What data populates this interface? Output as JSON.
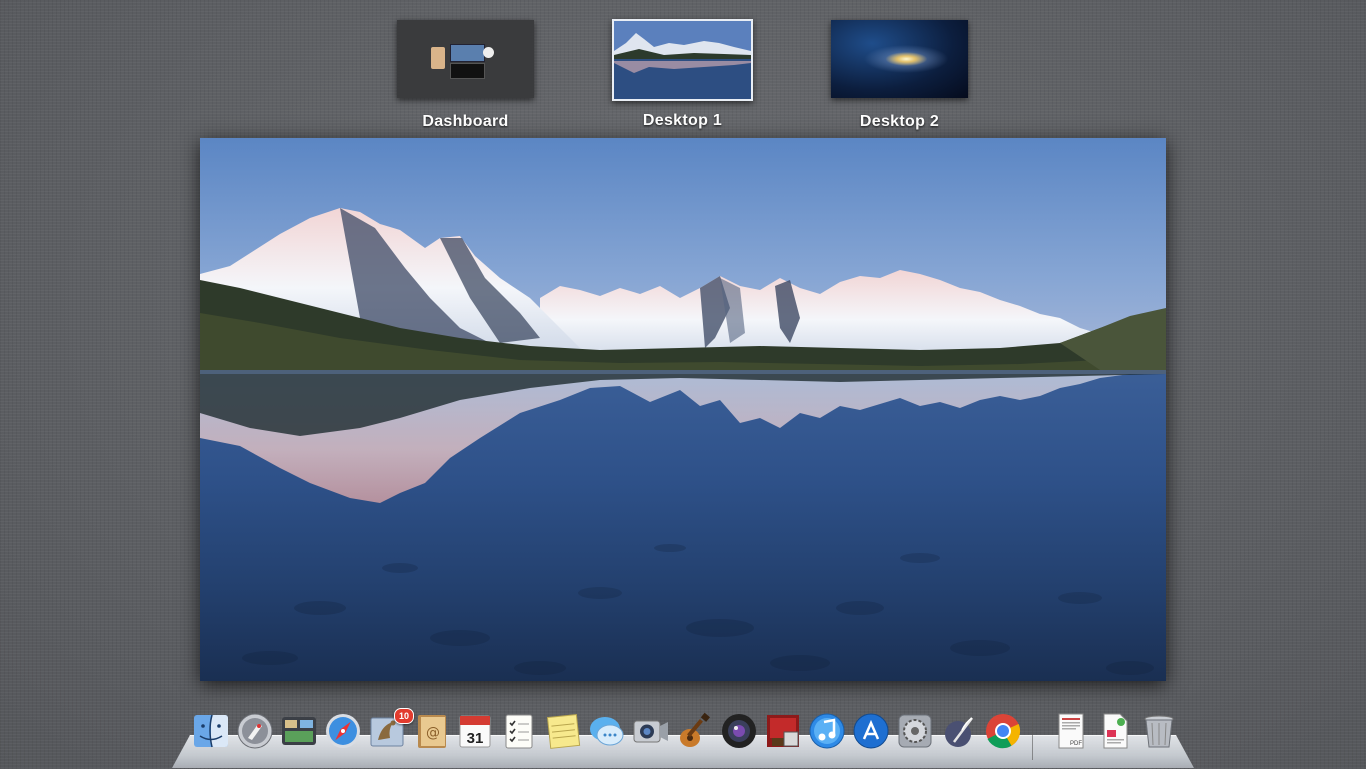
{
  "spaces": [
    {
      "label": "Dashboard",
      "thumb": "dashboard-thumbnail"
    },
    {
      "label": "Desktop 1",
      "thumb": "mountain-lake-thumbnail",
      "active": true
    },
    {
      "label": "Desktop 2",
      "thumb": "galaxy-thumbnail"
    }
  ],
  "desktop_preview": {
    "wallpaper": "mountain-lake-reflection"
  },
  "dock": {
    "items": [
      {
        "name": "Finder",
        "icon": "finder-icon"
      },
      {
        "name": "Launchpad",
        "icon": "launchpad-icon"
      },
      {
        "name": "Mission Control",
        "icon": "mission-control-icon"
      },
      {
        "name": "Safari",
        "icon": "safari-icon"
      },
      {
        "name": "Mail",
        "icon": "mail-icon",
        "badge": "10"
      },
      {
        "name": "Contacts",
        "icon": "contacts-icon"
      },
      {
        "name": "Calendar",
        "icon": "calendar-icon",
        "date": "31"
      },
      {
        "name": "Reminders",
        "icon": "reminders-icon"
      },
      {
        "name": "Notes",
        "icon": "notes-icon"
      },
      {
        "name": "Messages",
        "icon": "messages-icon"
      },
      {
        "name": "FaceTime",
        "icon": "facetime-icon"
      },
      {
        "name": "GarageBand",
        "icon": "garageband-icon"
      },
      {
        "name": "Photo Booth",
        "icon": "photo-booth-icon"
      },
      {
        "name": "Photo Booth Theater",
        "icon": "movie-theater-icon"
      },
      {
        "name": "iTunes",
        "icon": "itunes-icon"
      },
      {
        "name": "App Store",
        "icon": "app-store-icon"
      },
      {
        "name": "System Preferences",
        "icon": "system-preferences-icon"
      },
      {
        "name": "Preview",
        "icon": "quill-icon"
      },
      {
        "name": "Google Chrome",
        "icon": "chrome-icon"
      },
      {
        "name": "PDF Document",
        "icon": "pdf-document-icon",
        "doc_label": "PDF"
      },
      {
        "name": "Document",
        "icon": "document-icon"
      },
      {
        "name": "Trash",
        "icon": "trash-icon"
      }
    ]
  },
  "colors": {
    "background": "#5e6064",
    "label_text": "#ffffff",
    "badge": "#e23b2e"
  }
}
